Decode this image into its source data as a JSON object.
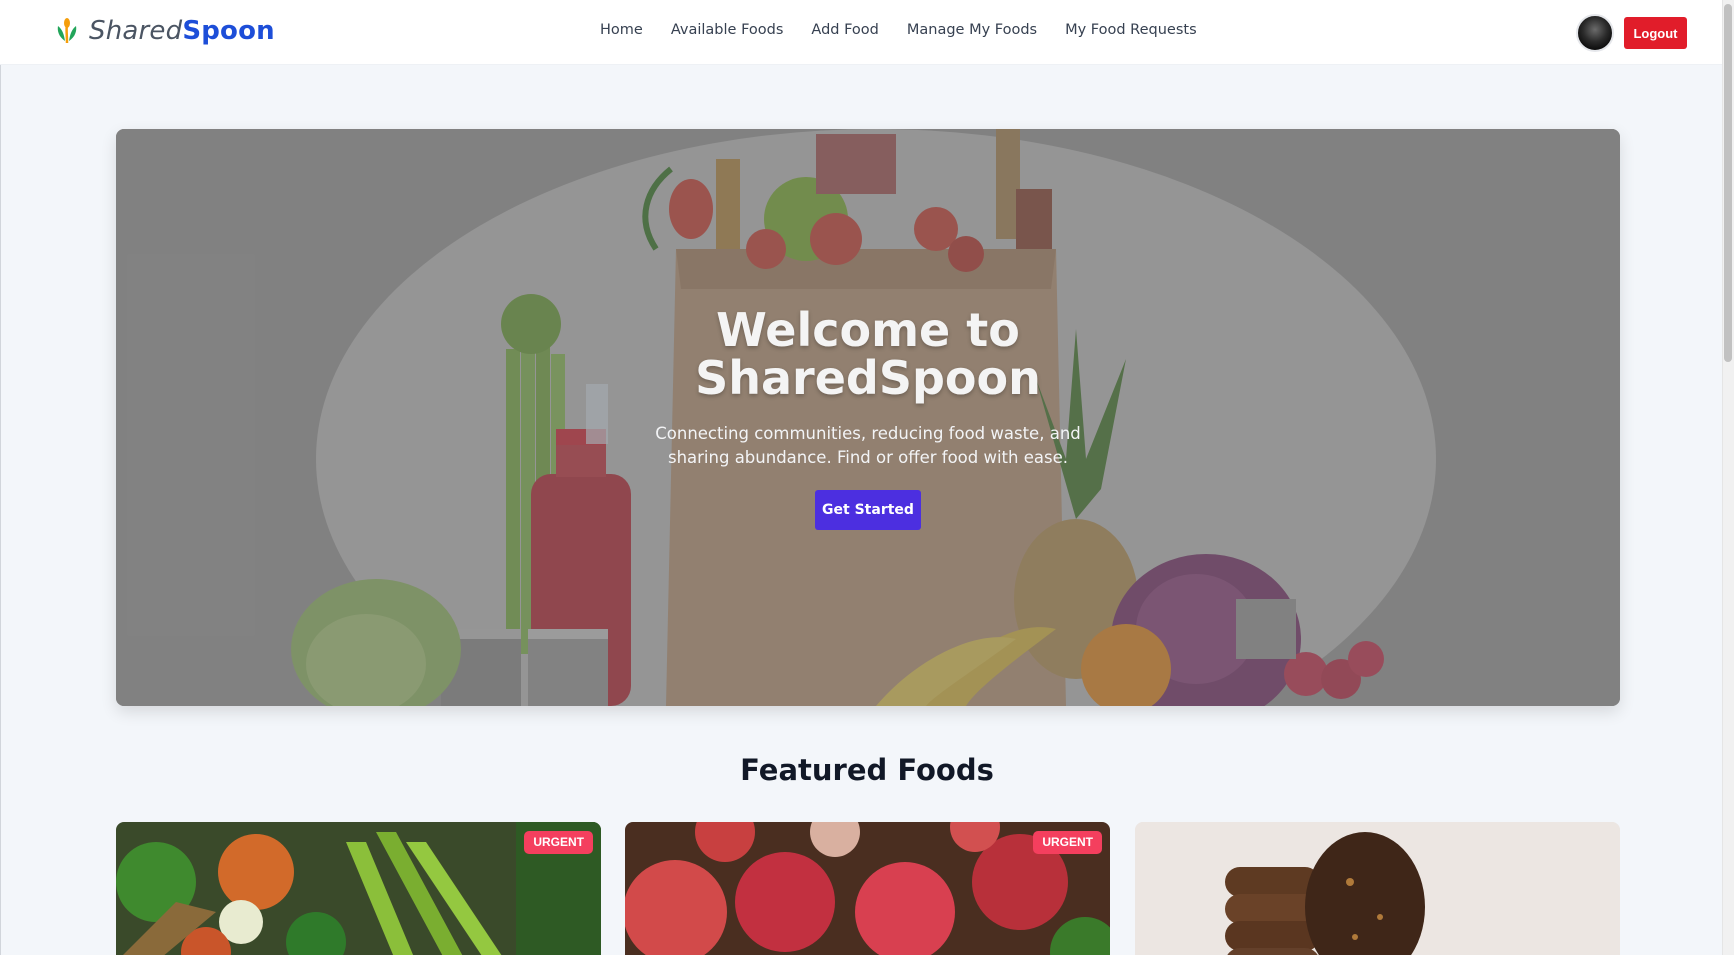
{
  "brand": {
    "part1": "Shared",
    "part2": "Spoon"
  },
  "nav": {
    "links": [
      "Home",
      "Available Foods",
      "Add Food",
      "Manage My Foods",
      "My Food Requests"
    ]
  },
  "user": {
    "logout_label": "Logout"
  },
  "hero": {
    "title_line1": "Welcome to",
    "title_line2": "SharedSpoon",
    "subtitle": "Connecting communities, reducing food waste, and sharing abundance. Find or offer food with ease.",
    "cta_label": "Get Started"
  },
  "featured": {
    "title": "Featured Foods",
    "cards": [
      {
        "badge": "URGENT",
        "image": "vegetables-basket"
      },
      {
        "badge": "URGENT",
        "image": "red-apples"
      },
      {
        "badge": "",
        "image": "chocolate-cookies"
      }
    ]
  },
  "colors": {
    "accent": "#1d4ed8",
    "logout": "#e11d2a",
    "cta": "#4c2fe0",
    "badge": "#f43f5e"
  }
}
